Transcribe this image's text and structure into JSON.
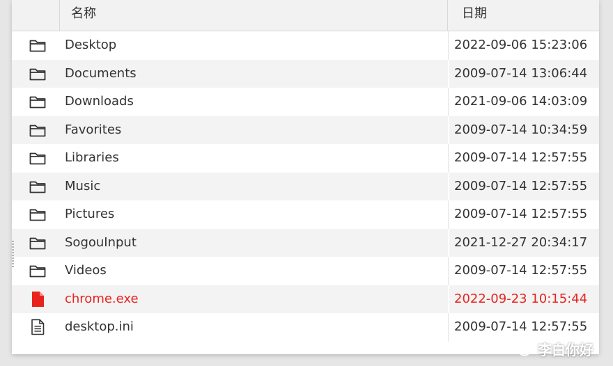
{
  "header": {
    "icon_col": "",
    "name_col": "名称",
    "date_col": "日期"
  },
  "files": [
    {
      "name": "Desktop",
      "date": "2022-09-06 15:23:06",
      "icon": "folder-icon"
    },
    {
      "name": "Documents",
      "date": "2009-07-14 13:06:44",
      "icon": "folder-icon"
    },
    {
      "name": "Downloads",
      "date": "2021-09-06 14:03:09",
      "icon": "folder-icon"
    },
    {
      "name": "Favorites",
      "date": "2009-07-14 10:34:59",
      "icon": "folder-icon"
    },
    {
      "name": "Libraries",
      "date": "2009-07-14 12:57:55",
      "icon": "folder-icon"
    },
    {
      "name": "Music",
      "date": "2009-07-14 12:57:55",
      "icon": "folder-icon"
    },
    {
      "name": "Pictures",
      "date": "2009-07-14 12:57:55",
      "icon": "folder-icon"
    },
    {
      "name": "SogouInput",
      "date": "2021-12-27 20:34:17",
      "icon": "folder-icon"
    },
    {
      "name": "Videos",
      "date": "2009-07-14 12:57:55",
      "icon": "folder-icon"
    },
    {
      "name": "chrome.exe",
      "date": "2022-09-23 10:15:44",
      "icon": "executable-file-icon",
      "highlight_color": "#e8231e"
    },
    {
      "name": "desktop.ini",
      "date": "2009-07-14 12:57:55",
      "icon": "text-file-icon"
    }
  ],
  "watermark": {
    "text": "李白你好",
    "icon": "wechat-icon"
  },
  "colors": {
    "highlight": "#e8231e",
    "header_bg": "#f2f2f2",
    "alt_row_bg": "#f3f3f3"
  }
}
